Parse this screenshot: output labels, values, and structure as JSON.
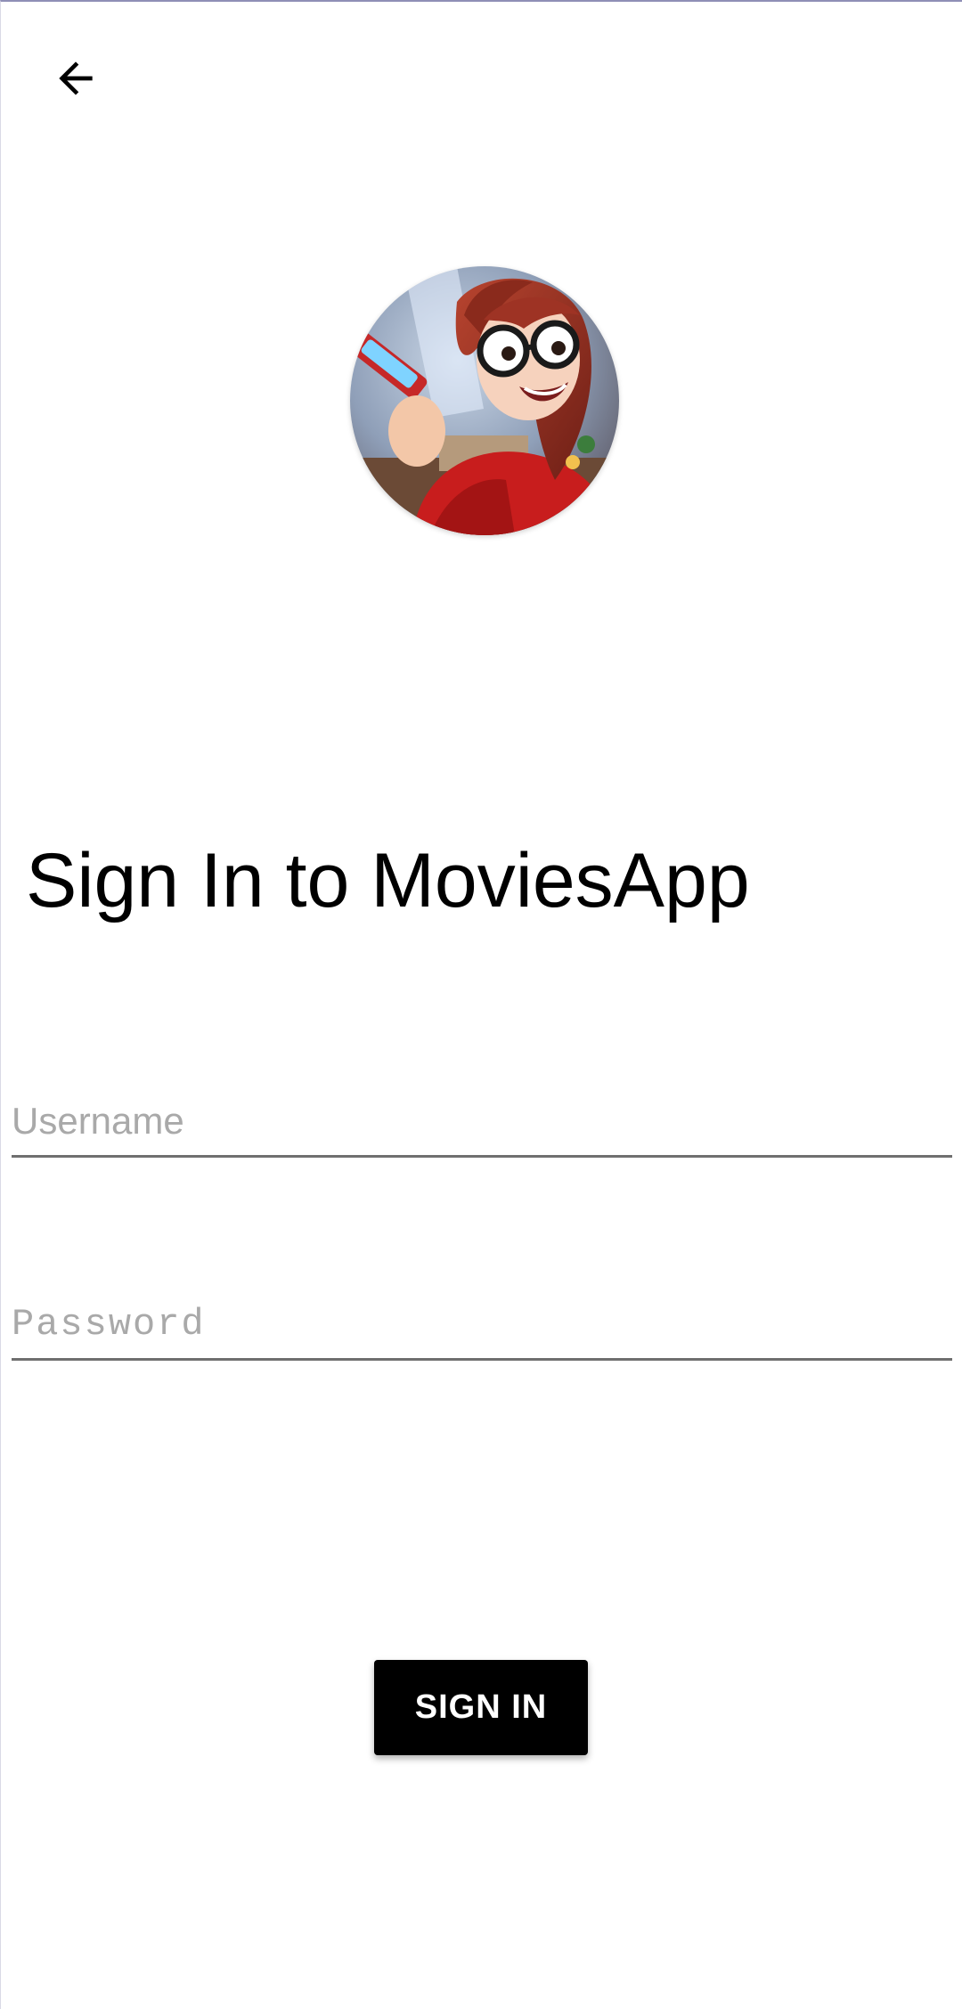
{
  "nav": {
    "back_icon": "arrow-back-icon"
  },
  "avatar": {
    "description_icon": "cartoon-avatar"
  },
  "header": {
    "title": "Sign In to MoviesApp"
  },
  "form": {
    "username_placeholder": "Username",
    "username_value": "",
    "password_placeholder": "Password",
    "password_value": "",
    "submit_label": "SIGN IN"
  },
  "colors": {
    "background": "#ffffff",
    "button_bg": "#000000",
    "button_text": "#ffffff",
    "placeholder": "#a9a9a9",
    "underline": "#6f6f6f"
  }
}
